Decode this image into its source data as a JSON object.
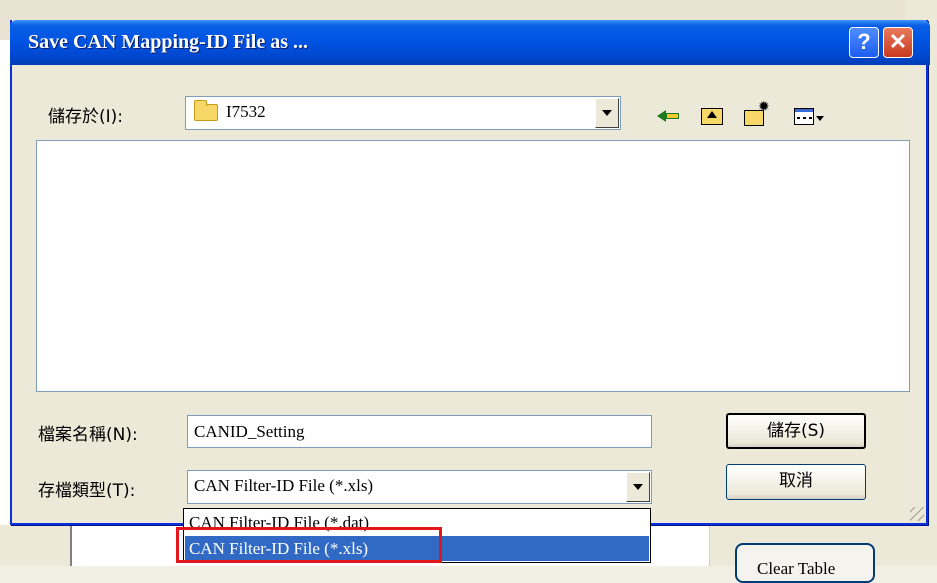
{
  "dialog": {
    "title": "Save CAN Mapping-ID File as ...",
    "help_label": "?",
    "close_label": "✕"
  },
  "save_in": {
    "label": "儲存於(I):",
    "value": "I7532"
  },
  "toolbar": {
    "icons": [
      "back-icon",
      "up-folder-icon",
      "new-folder-icon",
      "view-menu-icon"
    ]
  },
  "file_name": {
    "label": "檔案名稱(N):",
    "value": "CANID_Setting"
  },
  "file_type": {
    "label": "存檔類型(T):",
    "value": "CAN Filter-ID File (*.xls)",
    "options": [
      "CAN Filter-ID File (*.dat)",
      "CAN Filter-ID File (*.xls)"
    ],
    "selected_index": 1
  },
  "buttons": {
    "save": "儲存(S)",
    "cancel": "取消"
  },
  "background": {
    "button_text": "Clear Table"
  },
  "colors": {
    "titlebar": "#0054e3",
    "selection": "#316ac5",
    "annotation": "#e3161b"
  }
}
